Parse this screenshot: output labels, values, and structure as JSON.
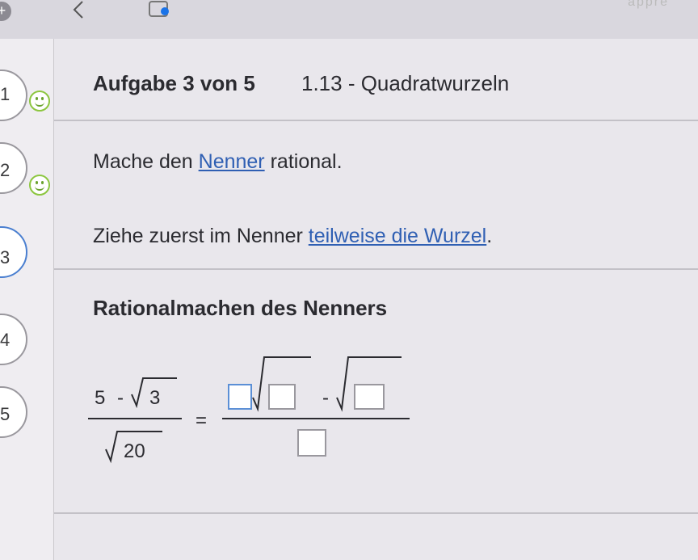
{
  "topbar": {
    "more_text": "appre"
  },
  "sidebar": {
    "steps": [
      {
        "num": "1"
      },
      {
        "num": "2"
      },
      {
        "num": "3"
      },
      {
        "num": "4"
      },
      {
        "num": "5"
      }
    ]
  },
  "task": {
    "label": "Aufgabe 3 von 5",
    "topic": "1.13 - Quadratwurzeln"
  },
  "instruction1": {
    "before": "Mache den ",
    "link": "Nenner",
    "after": " rational."
  },
  "instruction2": {
    "before": "Ziehe zuerst im Nenner ",
    "link": "teilweise die Wurzel",
    "after": "."
  },
  "section_heading": "Rationalmachen des Nenners",
  "equation": {
    "lhs_num_a": "5",
    "lhs_num_op": "-",
    "lhs_num_rad": "3",
    "lhs_den_rad": "20",
    "equals": "=",
    "rhs_op": "-"
  }
}
